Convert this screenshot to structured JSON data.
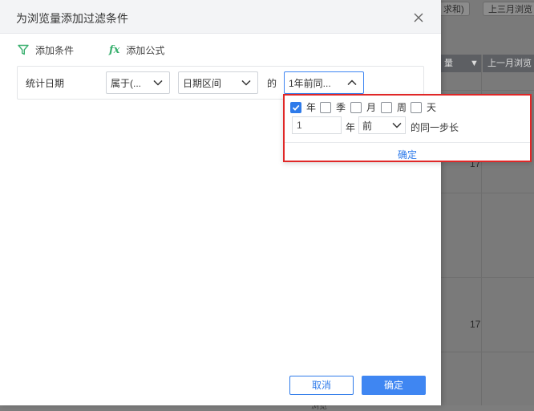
{
  "background": {
    "chips": [
      "求和)",
      "上三月浏览"
    ],
    "headers": [
      "量",
      "上一月浏览"
    ],
    "numbers": [
      "17",
      "17"
    ],
    "bottom_fragment": "浏览"
  },
  "dialog": {
    "title": "为浏览量添加过滤条件",
    "add_condition_label": "添加条件",
    "add_formula_label": "添加公式",
    "condition": {
      "field": "统计日期",
      "operator": "属于(...",
      "range_type": "日期区间",
      "of_text": "的",
      "period": "1年前同..."
    },
    "popup": {
      "units": [
        {
          "label": "年",
          "checked": true
        },
        {
          "label": "季",
          "checked": false
        },
        {
          "label": "月",
          "checked": false
        },
        {
          "label": "周",
          "checked": false
        },
        {
          "label": "天",
          "checked": false
        }
      ],
      "amount": "1",
      "amount_unit": "年",
      "direction": "前",
      "suffix": "的同一步长",
      "ok_label": "确定"
    },
    "cancel_label": "取消",
    "confirm_label": "确定"
  },
  "colors": {
    "accent": "#3f86f2",
    "highlight_border": "#e02727",
    "formula_green": "#3ab06f"
  }
}
